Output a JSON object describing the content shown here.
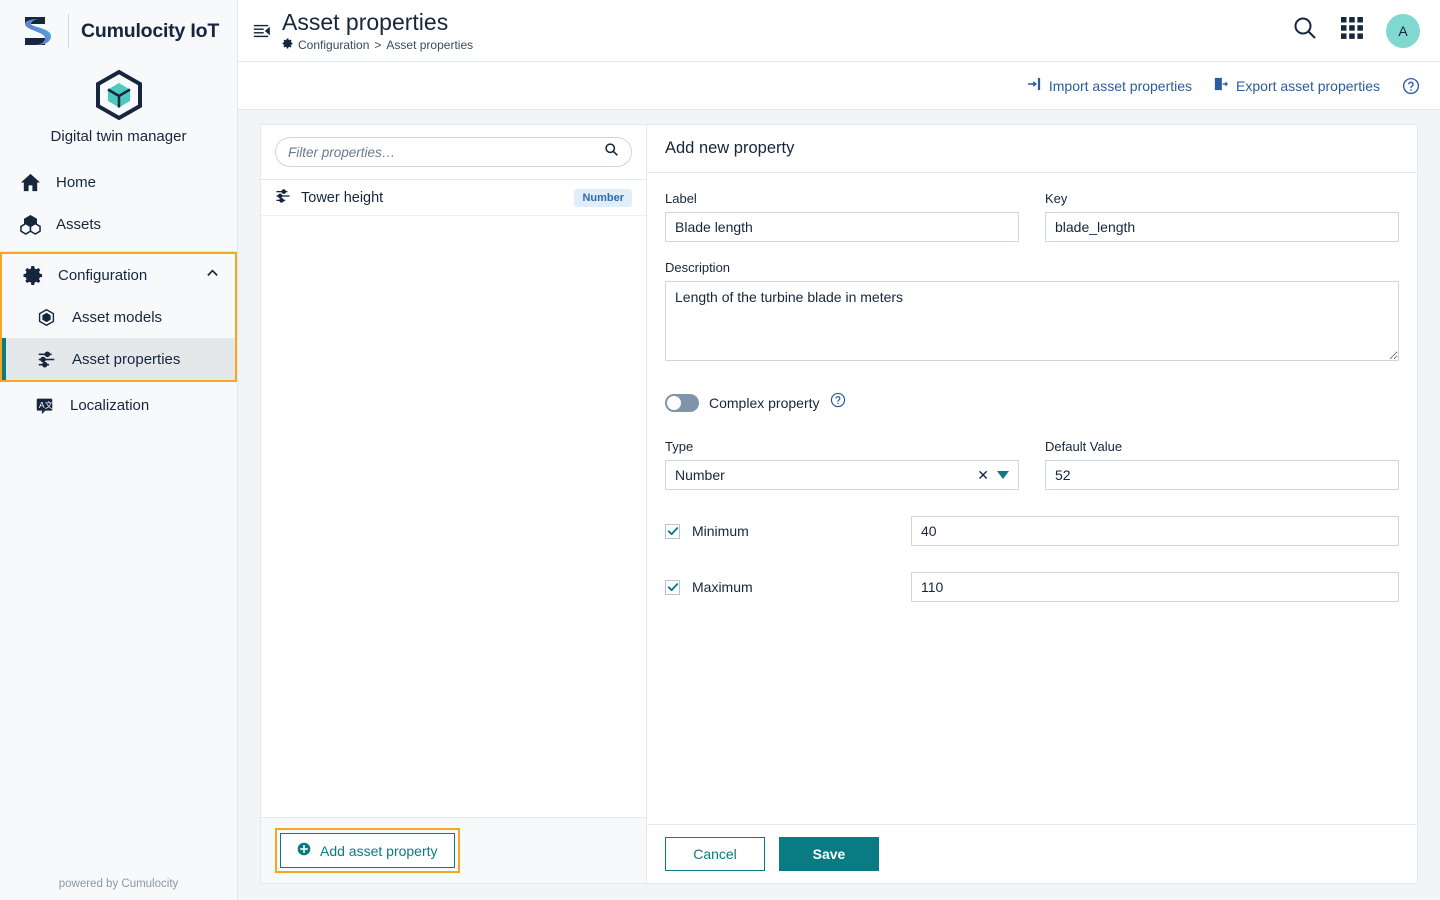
{
  "brand": {
    "name": "Cumulocity IoT",
    "logo_icon": "cumulocity-s-logo",
    "app_icon": "cube-hexagon-icon",
    "app_title": "Digital twin manager",
    "footer": "powered by Cumulocity"
  },
  "sidebar": {
    "items": [
      {
        "label": "Home",
        "icon": "home-icon"
      },
      {
        "label": "Assets",
        "icon": "assets-cubes-icon"
      }
    ],
    "configuration": {
      "label": "Configuration",
      "icon": "gear-icon",
      "chevron": "chevron-up-icon",
      "expanded": true,
      "highlight_color": "#f5a623",
      "children": [
        {
          "label": "Asset models",
          "icon": "cube-outline-icon",
          "active": false
        },
        {
          "label": "Asset properties",
          "icon": "sliders-icon",
          "active": true
        },
        {
          "label": "Localization",
          "icon": "translate-icon",
          "active": false
        }
      ]
    }
  },
  "header": {
    "collapse_icon": "collapse-sidebar-icon",
    "title": "Asset properties",
    "breadcrumb": {
      "icon": "gear-icon",
      "parent": "Configuration",
      "separator": ">",
      "current": "Asset properties"
    },
    "search_icon": "search-icon",
    "apps_icon": "app-grid-icon",
    "avatar_initial": "A",
    "avatar_color": "#7fd9d0"
  },
  "actionbar": {
    "import_label": "Import asset properties",
    "import_icon": "import-icon",
    "export_label": "Export asset properties",
    "export_icon": "export-icon",
    "help_icon": "help-circle-icon",
    "link_color": "#2b5c9e"
  },
  "list_panel": {
    "filter": {
      "placeholder": "Filter properties…",
      "value": "",
      "icon": "search-icon"
    },
    "rows": [
      {
        "icon": "sliders-icon",
        "label": "Tower height",
        "badge": "Number"
      }
    ],
    "add_button": {
      "label": "Add asset property",
      "icon": "plus-circle-icon",
      "highlight_color": "#f5a623"
    }
  },
  "form": {
    "title": "Add new property",
    "label_field": {
      "label": "Label",
      "value": "Blade length"
    },
    "key_field": {
      "label": "Key",
      "value": "blade_length"
    },
    "description_field": {
      "label": "Description",
      "value": "Length of the turbine blade in meters"
    },
    "complex_toggle": {
      "label": "Complex property",
      "state": "off",
      "help_icon": "help-circle-icon"
    },
    "type_field": {
      "label": "Type",
      "value": "Number",
      "clear_icon": "clear-x-icon",
      "caret_icon": "caret-down-icon",
      "options": [
        "Number"
      ]
    },
    "default_value_field": {
      "label": "Default Value",
      "value": "52"
    },
    "minimum": {
      "label": "Minimum",
      "checked": true,
      "value": "40"
    },
    "maximum": {
      "label": "Maximum",
      "checked": true,
      "value": "110"
    },
    "cancel_label": "Cancel",
    "save_label": "Save",
    "accent_color": "#0a7b83"
  }
}
